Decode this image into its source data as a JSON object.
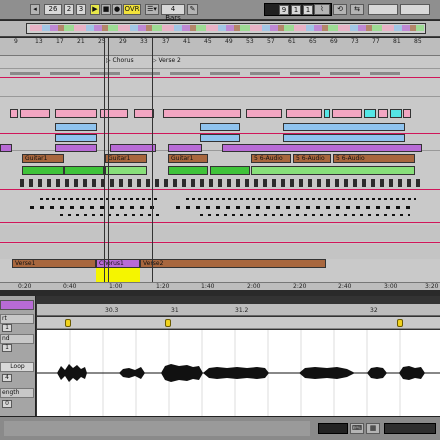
{
  "transport": {
    "tempo_display": "26",
    "bar": "2",
    "beat": "3",
    "ovr_label": "OVR",
    "quant_label": "4 Bars",
    "position": [
      "9",
      "1",
      "1"
    ]
  },
  "colors": {
    "background": "#c9c9c9",
    "pink_line": "#d0165a",
    "clip_pink": "#f2a6c2",
    "clip_blue": "#8fc3ee",
    "clip_purple": "#b86bd6",
    "clip_brown": "#a8673e",
    "clip_green": "#3fc33a",
    "clip_lightgreen": "#88e07a",
    "clip_cyan": "#55e6e6",
    "waveform": "#111111",
    "selection_yellow": "#f5f500"
  },
  "ruler": {
    "bars": [
      "9",
      "13",
      "17",
      "21",
      "25",
      "29",
      "33",
      "37",
      "41",
      "45",
      "49",
      "53",
      "57",
      "61",
      "65",
      "69",
      "73",
      "77",
      "81",
      "85"
    ]
  },
  "locators": [
    {
      "label": "Chorus"
    },
    {
      "label": "Verse 2"
    }
  ],
  "clips": {
    "guitar": [
      "Guitar1",
      "Guitar1",
      "Guitar1"
    ],
    "audio": [
      "5 6-Audio",
      "5 6-Audio",
      "5 6-Audio"
    ],
    "arrangement": [
      "Verse1",
      "Chorus1",
      "Verse2"
    ]
  },
  "time_ruler": {
    "labels": [
      "0:20",
      "0:40",
      "1:00",
      "1:20",
      "1:40",
      "2:00",
      "2:20",
      "2:40",
      "3:00",
      "3:20"
    ]
  },
  "detail": {
    "ruler": [
      "30.3",
      "31",
      "31.2",
      "32"
    ],
    "left_labels": [
      "rt",
      "nd",
      "Loop",
      "ength"
    ],
    "small_fields": [
      "1",
      "1",
      "4",
      "0"
    ]
  }
}
